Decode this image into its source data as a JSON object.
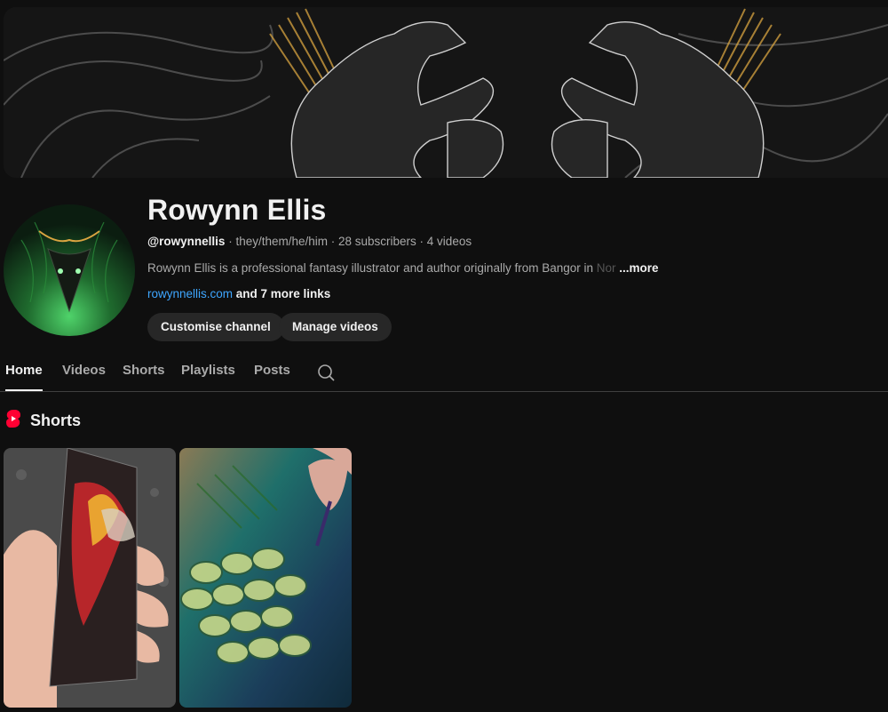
{
  "channel": {
    "name": "Rowynn Ellis",
    "handle": "@rowynnellis",
    "pronouns": "they/them/he/him",
    "subscribers": "28 subscribers",
    "videos": "4 videos",
    "separator": " · ",
    "description": "Rowynn Ellis is a professional fantasy illustrator and author originally from Bangor in ",
    "description_fade": "Nor",
    "description_more": "...more",
    "link_url": "rowynnellis.com",
    "link_more": " and 7 more links"
  },
  "buttons": {
    "customise": "Customise channel",
    "manage": "Manage videos"
  },
  "tabs": [
    "Home",
    "Videos",
    "Shorts",
    "Playlists",
    "Posts"
  ],
  "active_tab": "Home",
  "shorts_section": {
    "title": "Shorts",
    "icon": "shorts-icon",
    "items": [
      {
        "thumbnail": "bookmark-dragon-thumbnail"
      },
      {
        "thumbnail": "dragon-scales-painting-thumbnail"
      }
    ]
  },
  "colors": {
    "background": "#0f0f0f",
    "link": "#3ea6ff",
    "button": "#272727",
    "shorts_red": "#ff0033",
    "gold": "#d9a441"
  }
}
